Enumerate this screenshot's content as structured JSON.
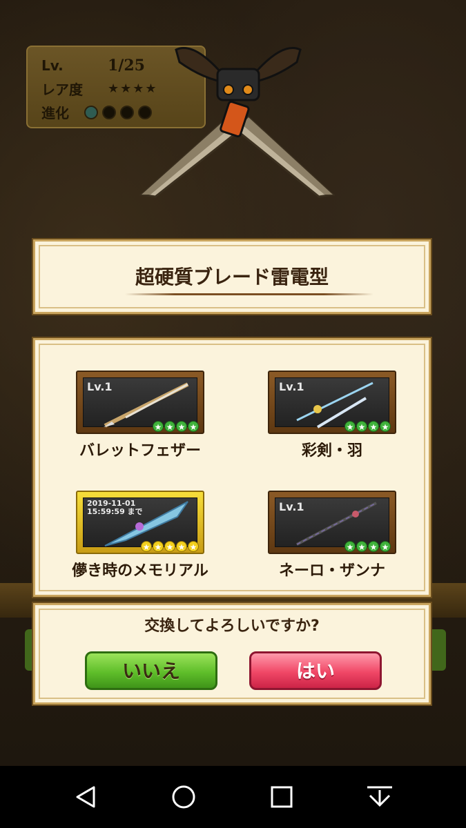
{
  "stats": {
    "level_label": "Lv.",
    "level_value": "1/25",
    "rarity_label": "レア度",
    "rarity_stars": 4,
    "evolution_label": "進化",
    "evolution_total": 4,
    "evolution_filled": 1
  },
  "title": "超硬質ブレード雷電型",
  "items": [
    {
      "badge": "Lv.1",
      "name": "バレットフェザー",
      "stars": 4,
      "star_color": "green",
      "frame": "wood"
    },
    {
      "badge": "Lv.1",
      "name": "彩剣・羽",
      "stars": 4,
      "star_color": "green",
      "frame": "wood"
    },
    {
      "badge_line1": "2019-11-01",
      "badge_line2": "15:59:59 まで",
      "name": "儚き時のメモリアル",
      "stars": 5,
      "star_color": "gold",
      "frame": "gold"
    },
    {
      "badge": "Lv.1",
      "name": "ネーロ・ザンナ",
      "stars": 4,
      "star_color": "green",
      "frame": "wood"
    }
  ],
  "confirm": {
    "question": "交換してよろしいですか?",
    "no_label": "いいえ",
    "yes_label": "はい"
  },
  "colors": {
    "parchment": "#fbf3dc",
    "no_button": "#5fbe2a",
    "yes_button": "#f04766",
    "star_green": "#3fb23b",
    "star_gold": "#f2cf1d"
  },
  "navbar": {
    "icons": [
      "back-icon",
      "home-icon",
      "recents-icon",
      "keyboard-hide-icon"
    ]
  }
}
